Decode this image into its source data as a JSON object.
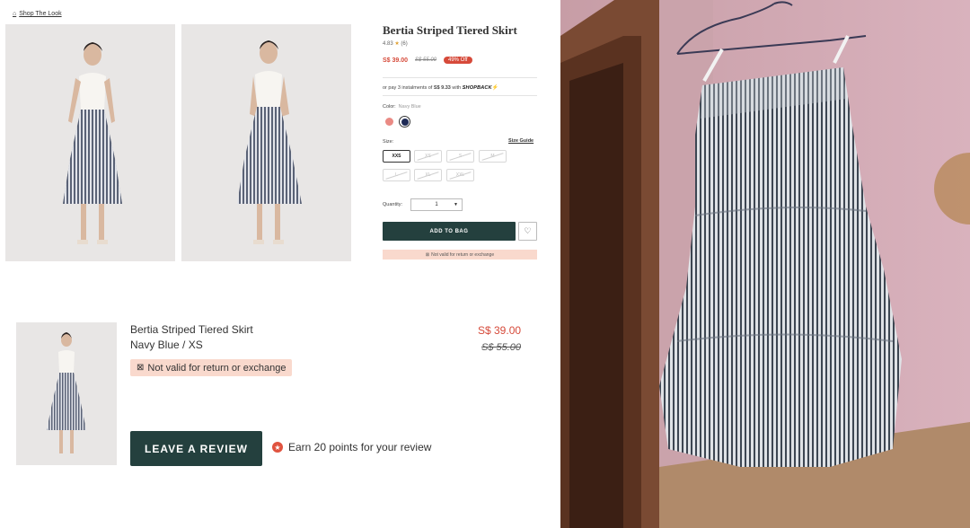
{
  "gallery": {
    "shop_the_look": "Shop The Look"
  },
  "product": {
    "title": "Bertia Striped Tiered Skirt",
    "rating": "4.83",
    "review_count": "(6)",
    "price": "S$ 39.00",
    "old_price": "S$ 55.00",
    "discount_badge": "49% Off",
    "installments_prefix": "or pay 3 instalments of",
    "installments_amount": "S$ 9.33",
    "installments_with": "with",
    "installments_brand": "SHOPBACK",
    "color_label": "Color:",
    "color_value": "Navy Blue",
    "colors": [
      "#ea8a84",
      "#1e2a55"
    ],
    "size_label": "Size:",
    "size_guide": "Size Guide",
    "sizes": [
      "XXS",
      "XS",
      "S",
      "M",
      "L",
      "XL",
      "XXL"
    ],
    "selected_size": "XXS",
    "quantity_label": "Quantity:",
    "quantity_value": "1",
    "add_to_bag": "ADD TO BAG",
    "not_valid_notice": "Not valid for return or exchange"
  },
  "order_item": {
    "name": "Bertia Striped Tiered Skirt",
    "variant": "Navy Blue / XS",
    "not_valid_notice": "Not valid for return or exchange",
    "price": "S$ 39.00",
    "old_price": "S$ 55.00",
    "review_button": "LEAVE A REVIEW",
    "earn_text": "Earn 20 points for your review"
  },
  "colors": {
    "accent_dark_green": "#24403e",
    "sale_red": "#d64a3a",
    "notice_peach": "#f9d9cd"
  }
}
